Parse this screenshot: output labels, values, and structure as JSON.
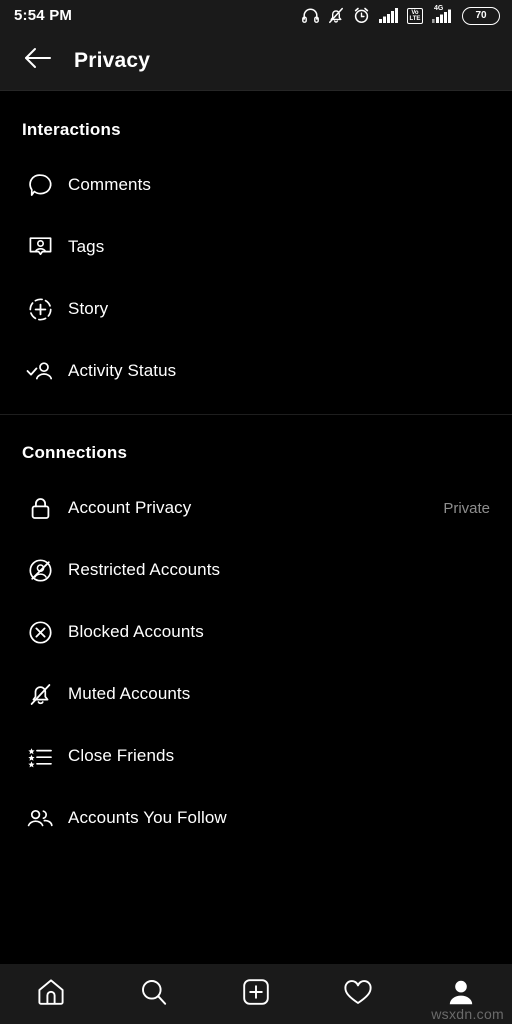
{
  "status_bar": {
    "time": "5:54 PM",
    "battery_level": "70",
    "icons": [
      "headphones-icon",
      "bell-off-icon",
      "alarm-clock-icon",
      "signal-bars-icon",
      "volte-icon",
      "signal-4g-icon",
      "battery-icon"
    ],
    "volte_top": "Vo",
    "volte_bottom": "LTE",
    "network_label": "4G"
  },
  "header": {
    "back_icon": "arrow-left-icon",
    "title": "Privacy"
  },
  "sections": [
    {
      "title": "Interactions",
      "items": [
        {
          "label": "Comments",
          "icon": "comment-bubble-icon",
          "value": ""
        },
        {
          "label": "Tags",
          "icon": "tag-person-icon",
          "value": ""
        },
        {
          "label": "Story",
          "icon": "story-plus-circle-icon",
          "value": ""
        },
        {
          "label": "Activity Status",
          "icon": "activity-check-person-icon",
          "value": ""
        }
      ]
    },
    {
      "title": "Connections",
      "items": [
        {
          "label": "Account Privacy",
          "icon": "lock-icon",
          "value": "Private"
        },
        {
          "label": "Restricted Accounts",
          "icon": "restricted-person-icon",
          "value": ""
        },
        {
          "label": "Blocked Accounts",
          "icon": "blocked-circle-x-icon",
          "value": ""
        },
        {
          "label": "Muted Accounts",
          "icon": "bell-off-icon",
          "value": ""
        },
        {
          "label": "Close Friends",
          "icon": "star-list-icon",
          "value": ""
        },
        {
          "label": "Accounts You Follow",
          "icon": "people-icon",
          "value": ""
        }
      ]
    }
  ],
  "bottom_nav": {
    "items": [
      {
        "name": "home-icon",
        "active": false
      },
      {
        "name": "search-icon",
        "active": false
      },
      {
        "name": "add-post-icon",
        "active": false
      },
      {
        "name": "heart-icon",
        "active": false
      },
      {
        "name": "profile-icon",
        "active": true
      }
    ]
  },
  "watermark": "wsxdn.com",
  "colors": {
    "background": "#000000",
    "surface": "#1a1a1a",
    "text_primary": "#ffffff",
    "text_secondary": "#8e8e8e",
    "divider": "#1e1e1e"
  }
}
